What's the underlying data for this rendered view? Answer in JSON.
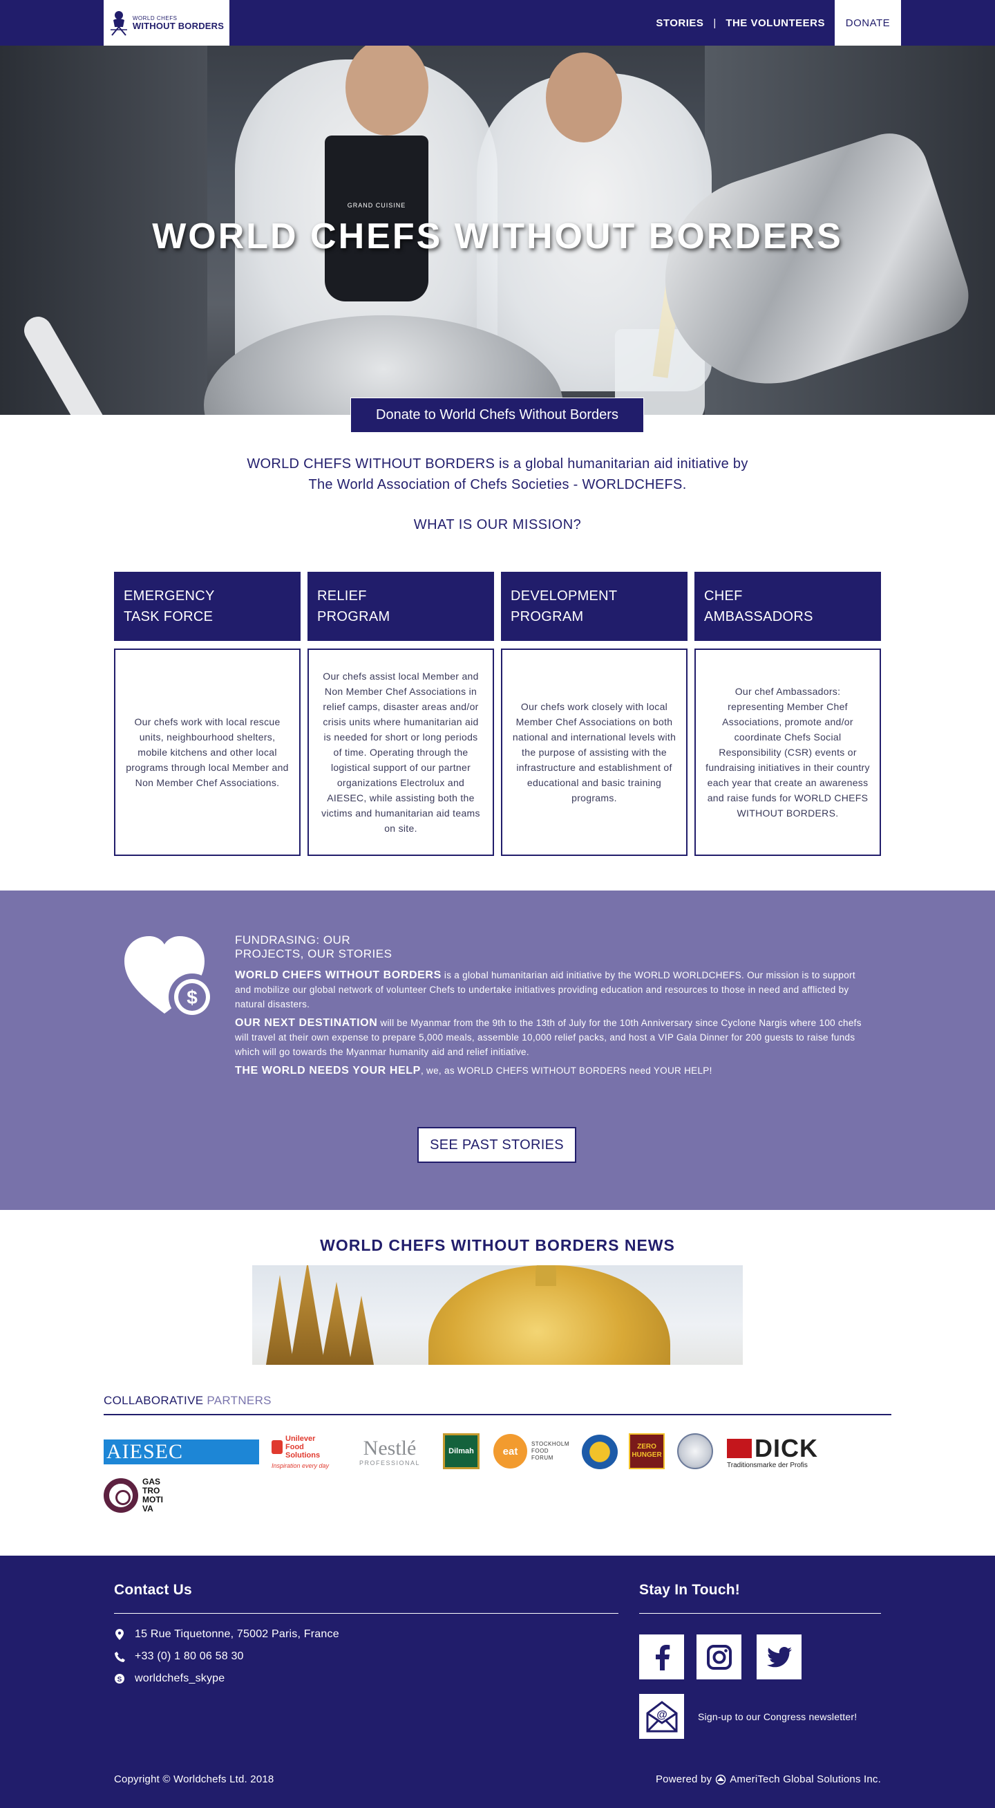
{
  "nav": {
    "logo_small": "WORLD CHEFS",
    "logo_big": "WITHOUT BORDERS",
    "links": [
      "STORIES",
      "THE VOLUNTEERS"
    ],
    "separator": "|",
    "donate": "DONATE"
  },
  "hero": {
    "title": "WORLD CHEFS WITHOUT BORDERS",
    "apron_text": "GRAND CUISINE",
    "donate_button": "Donate to World Chefs Without Borders"
  },
  "intro": {
    "line1": "WORLD CHEFS WITHOUT BORDERS is a global humanitarian aid initiative by",
    "line2": "The World Association of Chefs Societies - WORLDCHEFS.",
    "mission_heading": "WHAT IS OUR MISSION?"
  },
  "programs": [
    {
      "title": "EMERGENCY\nTASK FORCE",
      "text": "Our chefs work with local rescue units, neighbourhood shelters, mobile kitchens and other local programs through local Member and Non Member Chef Associations."
    },
    {
      "title": "RELIEF\nPROGRAM",
      "text": "Our chefs assist local Member and Non Member Chef Associations in relief camps, disaster areas and/or crisis units where humanitarian aid is needed for short or long periods of time. Operating through the logistical support of our partner organizations Electrolux and AIESEC, while assisting both the victims and humanitarian aid teams on site."
    },
    {
      "title": "DEVELOPMENT\nPROGRAM",
      "text": "Our chefs work closely with local Member Chef Associations on both national and international levels with the purpose of assisting with the infrastructure and establishment of educational and basic training programs."
    },
    {
      "title": "CHEF\nAMBASSADORS",
      "text": "Our chef Ambassadors: representing Member Chef Associations, promote and/or coordinate Chefs Social Responsibility (CSR) events or fundraising initiatives in their country each year that create an awareness and raise funds for WORLD CHEFS WITHOUT BORDERS."
    }
  ],
  "fundraising": {
    "heading": "FUNDRASING: OUR\nPROJECTS, OUR STORIES",
    "p1_bold": "WORLD CHEFS WITHOUT BORDERS",
    "p1": " is a global humanitarian aid initiative by the WORLD WORLDCHEFS. Our mission is to support and mobilize our global network of volunteer Chefs to undertake initiatives providing education and resources to those in need and afflicted by natural disasters.",
    "p2_bold": "OUR NEXT DESTINATION",
    "p2": " will be Myanmar from the 9th to the 13th of July for the 10th Anniversary since Cyclone Nargis where 100 chefs will travel at their own expense to prepare 5,000 meals, assemble 10,000 relief packs, and host a VIP Gala Dinner for 200 guests to raise funds which will go towards the Myanmar humanity aid and relief initiative.",
    "p3_bold": "THE WORLD NEEDS YOUR HELP",
    "p3": ", we, as WORLD CHEFS WITHOUT BORDERS need YOUR HELP!",
    "button": "SEE PAST STORIES"
  },
  "news": {
    "heading": "WORLD CHEFS WITHOUT BORDERS NEWS"
  },
  "partners": {
    "heading_1": "COLLABORATIVE",
    "heading_2": " PARTNERS",
    "aiesec": "AIESEC",
    "unilever_name": "Unilever\nFood\nSolutions",
    "unilever_tag": "Inspiration every day",
    "nestle_name": "Nestlé",
    "nestle_sub": "PROFESSIONAL",
    "dilmah": "Dilmah",
    "eat": "eat",
    "eat_text": "STOCKHOLM\nFOOD\nFORUM",
    "zero": "ZERO\nHUNGER",
    "dick_name": "DICK",
    "dick_sub": "Traditionsmarke der Profis",
    "gastro": "GAS\nTRO\nMOTI\nVA"
  },
  "footer": {
    "contact_heading": "Contact Us",
    "address": "15 Rue Tiquetonne, 75002 Paris, France",
    "phone": "+33 (0) 1 80 06 58 30",
    "skype": "worldchefs_skype",
    "stay_heading": "Stay In Touch!",
    "newsletter": "Sign-up to our Congress newsletter!",
    "copyright": "Copyright © Worldchefs Ltd. 2018",
    "powered_prefix": "Powered by",
    "powered_name": "AmeriTech Global Solutions Inc."
  },
  "colors": {
    "brand_navy": "#211d6b",
    "fund_purple": "#7872aa"
  }
}
